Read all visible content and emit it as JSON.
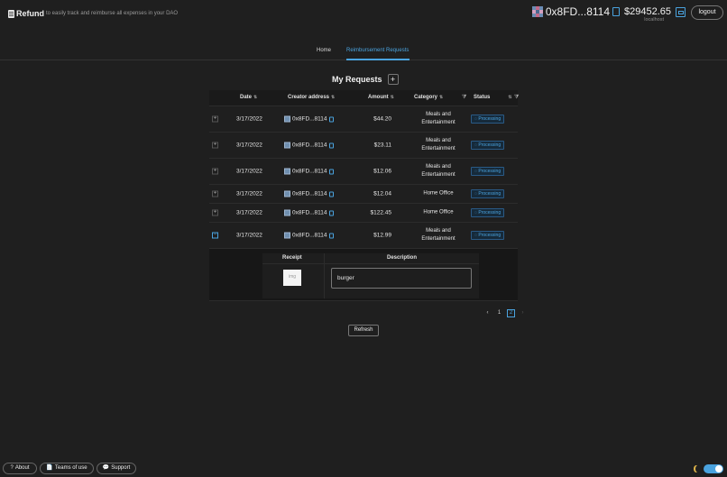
{
  "header": {
    "brand": "Refund",
    "tagline": "to easily track and reimburse all expenses in your DAO",
    "address": "0x8FD...8114",
    "balance": "$29452.65",
    "network": "localhost",
    "logout_label": "logout"
  },
  "nav": {
    "tabs": [
      {
        "label": "Home",
        "active": false
      },
      {
        "label": "Reimbursement Requests",
        "active": true
      }
    ]
  },
  "main": {
    "title": "My Requests",
    "add_label": "+",
    "columns": [
      "Date",
      "Creator address",
      "Amount",
      "Category",
      "Status"
    ],
    "rows": [
      {
        "date": "3/17/2022",
        "creator": "0x8FD...8114",
        "amount": "$44.20",
        "category": "Meals and Entertainment",
        "status": "Processing",
        "expanded": false
      },
      {
        "date": "3/17/2022",
        "creator": "0x8FD...8114",
        "amount": "$23.11",
        "category": "Meals and Entertainment",
        "status": "Processing",
        "expanded": false
      },
      {
        "date": "3/17/2022",
        "creator": "0x8FD...8114",
        "amount": "$12.06",
        "category": "Meals and Entertainment",
        "status": "Processing",
        "expanded": false
      },
      {
        "date": "3/17/2022",
        "creator": "0x8FD...8114",
        "amount": "$12.04",
        "category": "Home Office",
        "status": "Processing",
        "expanded": false
      },
      {
        "date": "3/17/2022",
        "creator": "0x8FD...8114",
        "amount": "$122.45",
        "category": "Home Office",
        "status": "Processing",
        "expanded": false
      },
      {
        "date": "3/17/2022",
        "creator": "0x8FD...8114",
        "amount": "$12.99",
        "category": "Meals and Entertainment",
        "status": "Processing",
        "expanded": true
      }
    ],
    "expanded_detail": {
      "receipt_header": "Receipt",
      "description_header": "Description",
      "receipt_thumb": "img",
      "description": "burger"
    },
    "pagination": {
      "prev": "‹",
      "pages": [
        "1",
        "2"
      ],
      "current": "2",
      "next": "›"
    },
    "refresh_label": "Refresh"
  },
  "footer": {
    "about": "About",
    "terms": "Teams of use",
    "support": "Support",
    "about_icon": "?",
    "terms_icon": "📄",
    "support_icon": "💬"
  },
  "colors": {
    "accent": "#4aa3df",
    "background": "#1f1f1f"
  }
}
